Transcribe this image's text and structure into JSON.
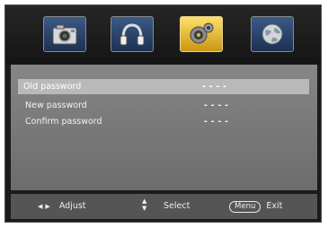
{
  "tabs": [
    {
      "name": "picture",
      "icon": "camera-icon",
      "active": false
    },
    {
      "name": "sound",
      "icon": "headphones-icon",
      "active": false
    },
    {
      "name": "setup",
      "icon": "gear-icon",
      "active": true
    },
    {
      "name": "network",
      "icon": "globe-icon",
      "active": false
    }
  ],
  "rows": [
    {
      "label": "Old password",
      "value": "----",
      "selected": true
    },
    {
      "label": "New password",
      "value": "----",
      "selected": false
    },
    {
      "label": "Confirm password",
      "value": "----",
      "selected": false
    }
  ],
  "footer": {
    "adjust_label": "Adjust",
    "select_label": "Select",
    "menu_key": "Menu",
    "exit_label": "Exit"
  },
  "colors": {
    "tab_active": "#f1c232",
    "tab_inactive": "#2a4a78",
    "panel": "#7a7a7a",
    "selection": "#b9b9b9"
  }
}
